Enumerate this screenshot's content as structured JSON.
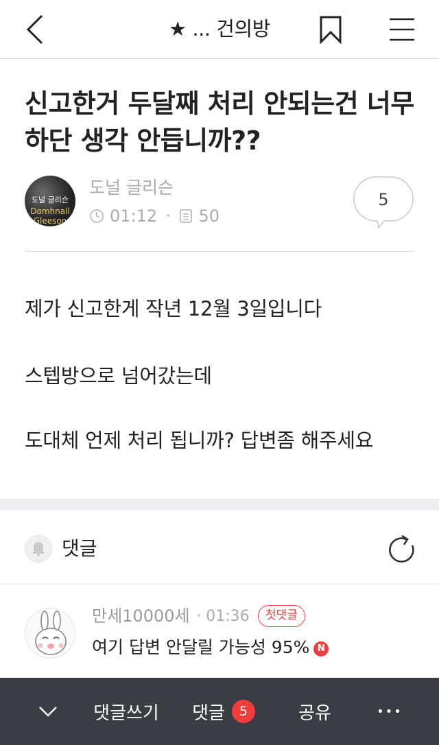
{
  "header": {
    "title": "★ ... 건의방",
    "icons": {
      "back": "chevron-left-icon",
      "bookmark": "bookmark-icon",
      "menu": "hamburger-menu-icon"
    }
  },
  "post": {
    "title": "신고한거 두달째 처리 안되는건 너무 하단 생각 안듭니까??",
    "author": "도널 글리슨",
    "avatar_text": [
      "도널 글리슨",
      "Domhnall",
      "Gleeson"
    ],
    "time": "01:12",
    "views": "50",
    "comment_count": "5",
    "body": [
      "제가 신고한게 작년 12월 3일입니다",
      "스텝방으로 넘어갔는데",
      "도대체 언제 처리 됩니까? 답변좀 해주세요"
    ]
  },
  "comments": {
    "label": "댓글",
    "items": [
      {
        "author": "만세10000세",
        "time": "01:36",
        "badge": "첫댓글",
        "text": "여기 답변 안달릴 가능성 95%",
        "new_badge": "N"
      }
    ]
  },
  "bottom_bar": {
    "write_label": "댓글쓰기",
    "comments_label": "댓글",
    "comments_count": "5",
    "share_label": "공유",
    "more_label": "•••"
  },
  "colors": {
    "accent_red": "#f23d3d",
    "bottom_bar_bg": "#3a3d44",
    "meta_gray": "#aaaaaa"
  }
}
